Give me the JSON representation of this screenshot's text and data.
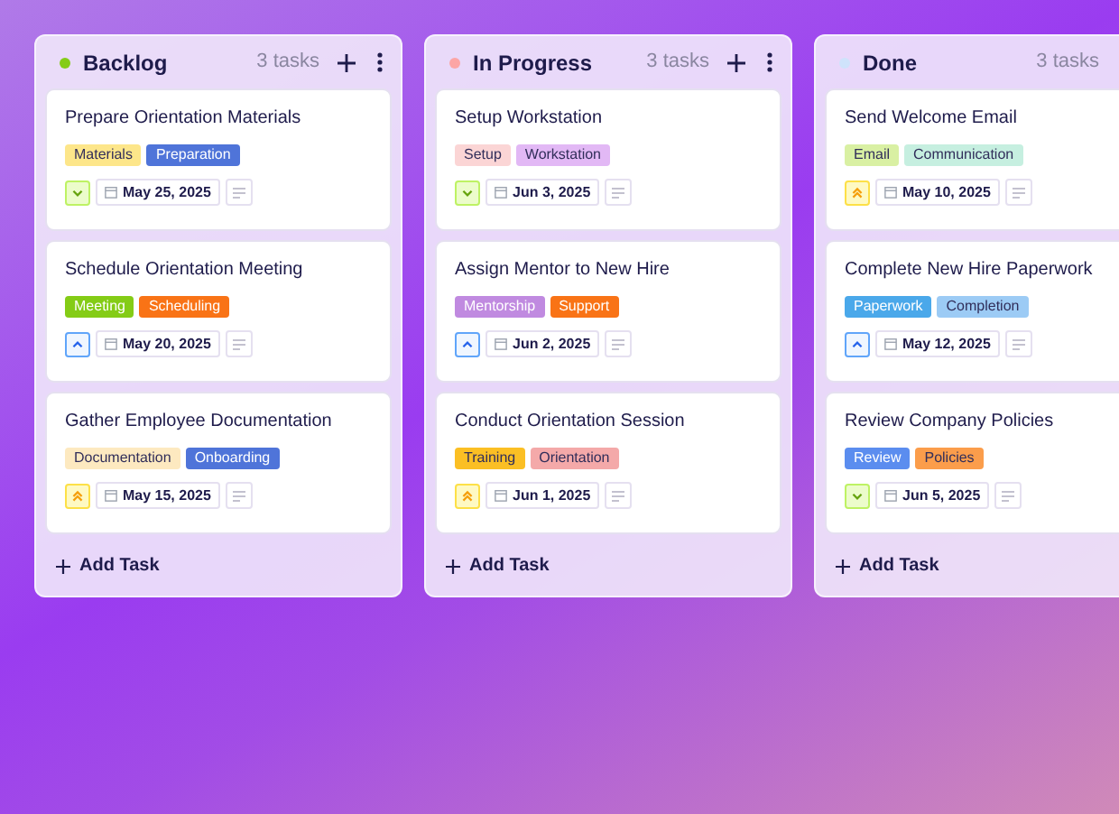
{
  "columns": [
    {
      "title": "Backlog",
      "color": "#84cc16",
      "count": "3 tasks",
      "actions": true,
      "add_label": "Add Task",
      "cards": [
        {
          "title": "Prepare Orientation Materials",
          "tags": [
            {
              "label": "Materials",
              "color": "#fde68a"
            },
            {
              "label": "Preparation",
              "color": "#4f74d9"
            }
          ],
          "priority": {
            "kind": "low"
          },
          "date": "May 25, 2025"
        },
        {
          "title": "Schedule Orientation Meeting",
          "tags": [
            {
              "label": "Meeting",
              "color": "#84cc16"
            },
            {
              "label": "Scheduling",
              "color": "#f97316"
            }
          ],
          "priority": {
            "kind": "medium"
          },
          "date": "May 20, 2025"
        },
        {
          "title": "Gather Employee Documentation",
          "tags": [
            {
              "label": "Documentation",
              "color": "#fde9c0"
            },
            {
              "label": "Onboarding",
              "color": "#4f74d9"
            }
          ],
          "priority": {
            "kind": "high"
          },
          "date": "May 15, 2025"
        }
      ]
    },
    {
      "title": "In Progress",
      "color": "#fca5a5",
      "count": "3 tasks",
      "actions": true,
      "add_label": "Add Task",
      "cards": [
        {
          "title": "Setup Workstation",
          "tags": [
            {
              "label": "Setup",
              "color": "#fbd5d5"
            },
            {
              "label": "Workstation",
              "color": "#e2b8f5"
            }
          ],
          "priority": {
            "kind": "low"
          },
          "date": "Jun 3, 2025"
        },
        {
          "title": "Assign Mentor to New Hire",
          "tags": [
            {
              "label": "Mentorship",
              "color": "#c08ae0"
            },
            {
              "label": "Support",
              "color": "#f97316"
            }
          ],
          "priority": {
            "kind": "medium"
          },
          "date": "Jun 2, 2025"
        },
        {
          "title": "Conduct Orientation Session",
          "tags": [
            {
              "label": "Training",
              "color": "#fbbf24"
            },
            {
              "label": "Orientation",
              "color": "#f4a9a9"
            }
          ],
          "priority": {
            "kind": "high"
          },
          "date": "Jun 1, 2025"
        }
      ]
    },
    {
      "title": "Done",
      "color": "#cfe3fb",
      "count": "3 tasks",
      "actions": false,
      "add_label": "Add Task",
      "cards": [
        {
          "title": "Send Welcome Email",
          "tags": [
            {
              "label": "Email",
              "color": "#d9f0a3"
            },
            {
              "label": "Communication",
              "color": "#c6efe0"
            }
          ],
          "priority": {
            "kind": "high"
          },
          "date": "May 10, 2025"
        },
        {
          "title": "Complete New Hire Paperwork",
          "tags": [
            {
              "label": "Paperwork",
              "color": "#4aa8ea"
            },
            {
              "label": "Completion",
              "color": "#9ccbf5"
            }
          ],
          "priority": {
            "kind": "medium"
          },
          "date": "May 12, 2025"
        },
        {
          "title": "Review Company Policies",
          "tags": [
            {
              "label": "Review",
              "color": "#5b8def"
            },
            {
              "label": "Policies",
              "color": "#fb9d4b"
            }
          ],
          "priority": {
            "kind": "low"
          },
          "date": "Jun 5, 2025"
        }
      ]
    }
  ]
}
